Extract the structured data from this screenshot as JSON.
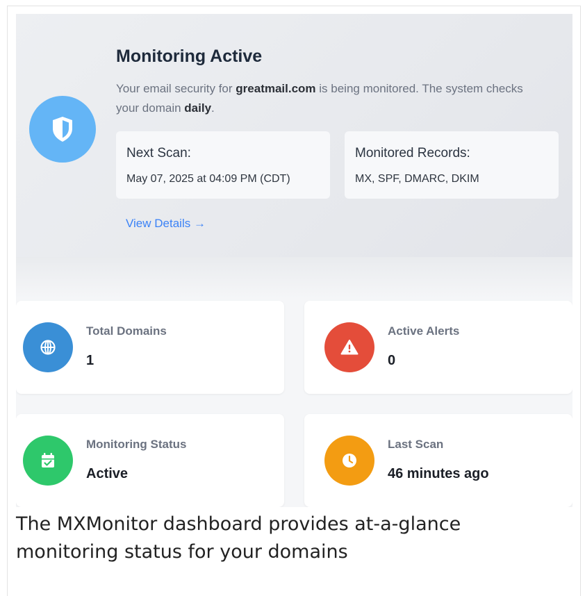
{
  "hero": {
    "title": "Monitoring Active",
    "desc_prefix": "Your email security for ",
    "domain": "greatmail.com",
    "desc_middle": " is being monitored. The system checks your domain ",
    "frequency": "daily",
    "desc_suffix": ".",
    "next_scan_label": "Next Scan:",
    "next_scan_value": "May 07, 2025 at 04:09 PM (CDT)",
    "records_label": "Monitored Records:",
    "records_value": "MX, SPF, DMARC, DKIM",
    "view_details": "View Details →",
    "icon": "shield-icon"
  },
  "stats": [
    {
      "title": "Total Domains",
      "value": "1",
      "icon": "globe-icon",
      "color": "#3a8fd6"
    },
    {
      "title": "Active Alerts",
      "value": "0",
      "icon": "warning-icon",
      "color": "#e44d3a"
    },
    {
      "title": "Monitoring Status",
      "value": "Active",
      "icon": "calendar-check-icon",
      "color": "#2ec86b"
    },
    {
      "title": "Last Scan",
      "value": "46 minutes ago",
      "icon": "clock-icon",
      "color": "#f39c12"
    }
  ],
  "caption": "The MXMonitor dashboard provides at-a-glance monitoring status for your domains"
}
